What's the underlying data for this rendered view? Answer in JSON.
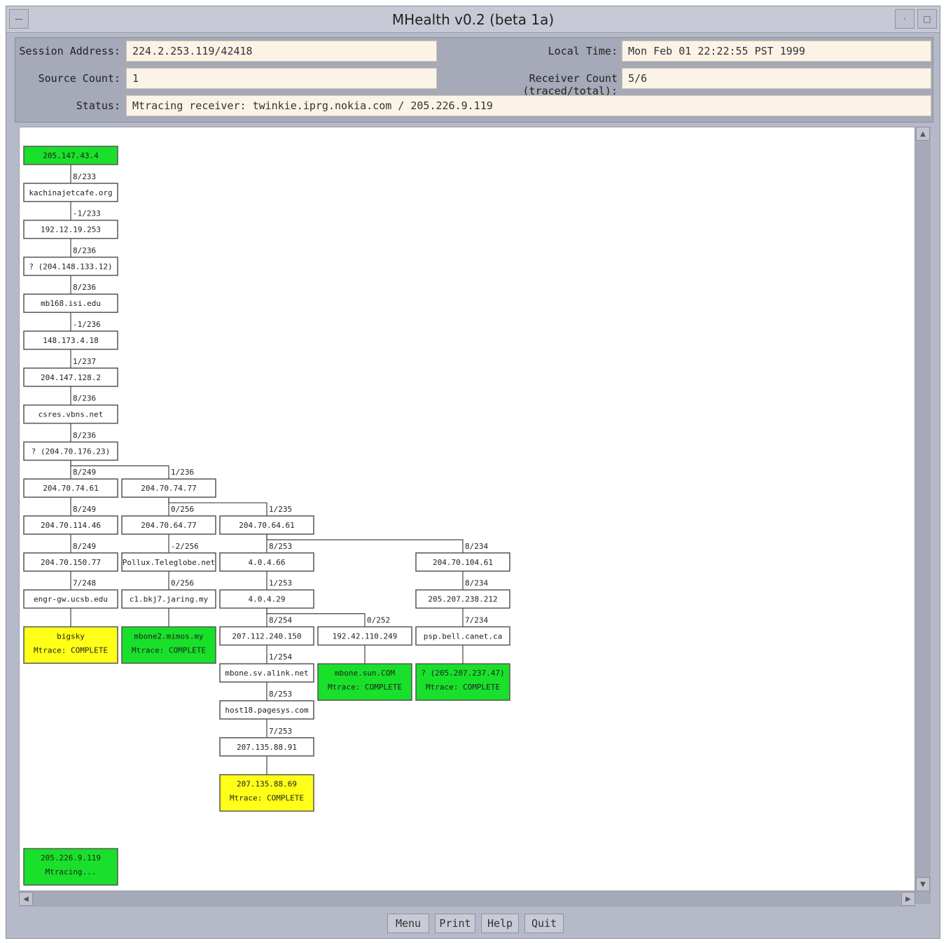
{
  "window": {
    "title": "MHealth v0.2 (beta 1a)"
  },
  "info": {
    "session_address_label": "Session Address:",
    "session_address": "224.2.253.119/42418",
    "local_time_label": "Local Time:",
    "local_time": "Mon Feb 01 22:22:55 PST 1999",
    "source_count_label": "Source Count:",
    "source_count": "1",
    "receiver_count_label": "Receiver Count (traced/total):",
    "receiver_count": "5/6",
    "status_label": "Status:",
    "status": "Mtracing receiver: twinkie.iprg.nokia.com / 205.226.9.119"
  },
  "colors": {
    "source": "#19e02a",
    "complete_yellow": "#ffff17",
    "complete_green": "#19e02a",
    "router": "#ffffff"
  },
  "tree": {
    "nodes": [
      {
        "id": "n0",
        "col": 0,
        "row": 0,
        "lines": [
          "205.147.43.4"
        ],
        "kind": "source"
      },
      {
        "id": "n1",
        "col": 0,
        "row": 1,
        "lines": [
          "kachinajetcafe.org"
        ],
        "kind": "router",
        "ttl": "8/233"
      },
      {
        "id": "n2",
        "col": 0,
        "row": 2,
        "lines": [
          "192.12.19.253"
        ],
        "kind": "router",
        "ttl": "-1/233"
      },
      {
        "id": "n3",
        "col": 0,
        "row": 3,
        "lines": [
          "? (204.148.133.12)"
        ],
        "kind": "router",
        "ttl": "8/236"
      },
      {
        "id": "n4",
        "col": 0,
        "row": 4,
        "lines": [
          "mb168.isi.edu"
        ],
        "kind": "router",
        "ttl": "8/236"
      },
      {
        "id": "n5",
        "col": 0,
        "row": 5,
        "lines": [
          "148.173.4.18"
        ],
        "kind": "router",
        "ttl": "-1/236"
      },
      {
        "id": "n6",
        "col": 0,
        "row": 6,
        "lines": [
          "204.147.128.2"
        ],
        "kind": "router",
        "ttl": "1/237"
      },
      {
        "id": "n7",
        "col": 0,
        "row": 7,
        "lines": [
          "csres.vbns.net"
        ],
        "kind": "router",
        "ttl": "8/236"
      },
      {
        "id": "n8",
        "col": 0,
        "row": 8,
        "lines": [
          "? (204.70.176.23)"
        ],
        "kind": "router",
        "ttl": "8/236"
      },
      {
        "id": "a1",
        "col": 0,
        "row": 9,
        "lines": [
          "204.70.74.61"
        ],
        "kind": "router",
        "ttl": "8/249"
      },
      {
        "id": "a2",
        "col": 0,
        "row": 10,
        "lines": [
          "204.70.114.46"
        ],
        "kind": "router",
        "ttl": "8/249"
      },
      {
        "id": "a3",
        "col": 0,
        "row": 11,
        "lines": [
          "204.70.150.77"
        ],
        "kind": "router",
        "ttl": "8/249"
      },
      {
        "id": "a4",
        "col": 0,
        "row": 12,
        "lines": [
          "engr-gw.ucsb.edu"
        ],
        "kind": "router",
        "ttl": "7/248"
      },
      {
        "id": "a5",
        "col": 0,
        "row": 13,
        "lines": [
          "bigsky",
          "Mtrace: COMPLETE"
        ],
        "kind": "complete_yellow"
      },
      {
        "id": "b1",
        "col": 1,
        "row": 9,
        "lines": [
          "204.70.74.77"
        ],
        "kind": "router",
        "ttl": "1/236"
      },
      {
        "id": "b2",
        "col": 1,
        "row": 10,
        "lines": [
          "204.70.64.77"
        ],
        "kind": "router",
        "ttl": "0/256"
      },
      {
        "id": "b3",
        "col": 1,
        "row": 11,
        "lines": [
          "Pollux.Teleglobe.net"
        ],
        "kind": "router",
        "ttl": "-2/256"
      },
      {
        "id": "b4",
        "col": 1,
        "row": 12,
        "lines": [
          "c1.bkj7.jaring.my"
        ],
        "kind": "router",
        "ttl": "0/256"
      },
      {
        "id": "b5",
        "col": 1,
        "row": 13,
        "lines": [
          "mbone2.mimos.my",
          "Mtrace: COMPLETE"
        ],
        "kind": "complete_green"
      },
      {
        "id": "c1",
        "col": 2,
        "row": 10,
        "lines": [
          "204.70.64.61"
        ],
        "kind": "router",
        "ttl": "1/235"
      },
      {
        "id": "c2",
        "col": 2,
        "row": 11,
        "lines": [
          "4.0.4.66"
        ],
        "kind": "router",
        "ttl": "8/253"
      },
      {
        "id": "c3",
        "col": 2,
        "row": 12,
        "lines": [
          "4.0.4.29"
        ],
        "kind": "router",
        "ttl": "1/253"
      },
      {
        "id": "c4",
        "col": 2,
        "row": 13,
        "lines": [
          "207.112.240.150"
        ],
        "kind": "router",
        "ttl": "8/254"
      },
      {
        "id": "c5",
        "col": 2,
        "row": 14,
        "lines": [
          "mbone.sv.alink.net"
        ],
        "kind": "router",
        "ttl": "1/254"
      },
      {
        "id": "c6",
        "col": 2,
        "row": 15,
        "lines": [
          "host18.pagesys.com"
        ],
        "kind": "router",
        "ttl": "8/253"
      },
      {
        "id": "c7",
        "col": 2,
        "row": 16,
        "lines": [
          "207.135.88.91"
        ],
        "kind": "router",
        "ttl": "7/253"
      },
      {
        "id": "c8",
        "col": 2,
        "row": 17,
        "lines": [
          "207.135.88.69",
          "Mtrace: COMPLETE"
        ],
        "kind": "complete_yellow"
      },
      {
        "id": "d1",
        "col": 3,
        "row": 13,
        "lines": [
          "192.42.110.249"
        ],
        "kind": "router",
        "ttl": "0/252"
      },
      {
        "id": "d2",
        "col": 3,
        "row": 14,
        "lines": [
          "mbone.sun.COM",
          "Mtrace: COMPLETE"
        ],
        "kind": "complete_green"
      },
      {
        "id": "e1",
        "col": 4,
        "row": 11,
        "lines": [
          "204.70.104.61"
        ],
        "kind": "router",
        "ttl": "8/234"
      },
      {
        "id": "e2",
        "col": 4,
        "row": 12,
        "lines": [
          "205.207.238.212"
        ],
        "kind": "router",
        "ttl": "8/234"
      },
      {
        "id": "e3",
        "col": 4,
        "row": 13,
        "lines": [
          "psp.bell.canet.ca"
        ],
        "kind": "router",
        "ttl": "7/234"
      },
      {
        "id": "e4",
        "col": 4,
        "row": 14,
        "lines": [
          "? (205.207.237.47)",
          "Mtrace: COMPLETE"
        ],
        "kind": "complete_green"
      },
      {
        "id": "r1",
        "col": 0,
        "row": 19,
        "lines": [
          "205.226.9.119",
          "Mtracing..."
        ],
        "kind": "source"
      }
    ],
    "edges": [
      [
        "n0",
        "n1"
      ],
      [
        "n1",
        "n2"
      ],
      [
        "n2",
        "n3"
      ],
      [
        "n3",
        "n4"
      ],
      [
        "n4",
        "n5"
      ],
      [
        "n5",
        "n6"
      ],
      [
        "n6",
        "n7"
      ],
      [
        "n7",
        "n8"
      ],
      [
        "n8",
        "a1"
      ],
      [
        "n8",
        "b1"
      ],
      [
        "a1",
        "a2"
      ],
      [
        "a2",
        "a3"
      ],
      [
        "a3",
        "a4"
      ],
      [
        "a4",
        "a5"
      ],
      [
        "b1",
        "b2"
      ],
      [
        "b1",
        "c1"
      ],
      [
        "b2",
        "b3"
      ],
      [
        "b3",
        "b4"
      ],
      [
        "b4",
        "b5"
      ],
      [
        "c1",
        "c2"
      ],
      [
        "c1",
        "e1"
      ],
      [
        "c2",
        "c3"
      ],
      [
        "c3",
        "c4"
      ],
      [
        "c3",
        "d1"
      ],
      [
        "c4",
        "c5"
      ],
      [
        "c5",
        "c6"
      ],
      [
        "c6",
        "c7"
      ],
      [
        "c7",
        "c8"
      ],
      [
        "d1",
        "d2"
      ],
      [
        "e1",
        "e2"
      ],
      [
        "e2",
        "e3"
      ],
      [
        "e3",
        "e4"
      ]
    ]
  },
  "buttons": {
    "menu": "Menu",
    "print": "Print",
    "help": "Help",
    "quit": "Quit"
  }
}
